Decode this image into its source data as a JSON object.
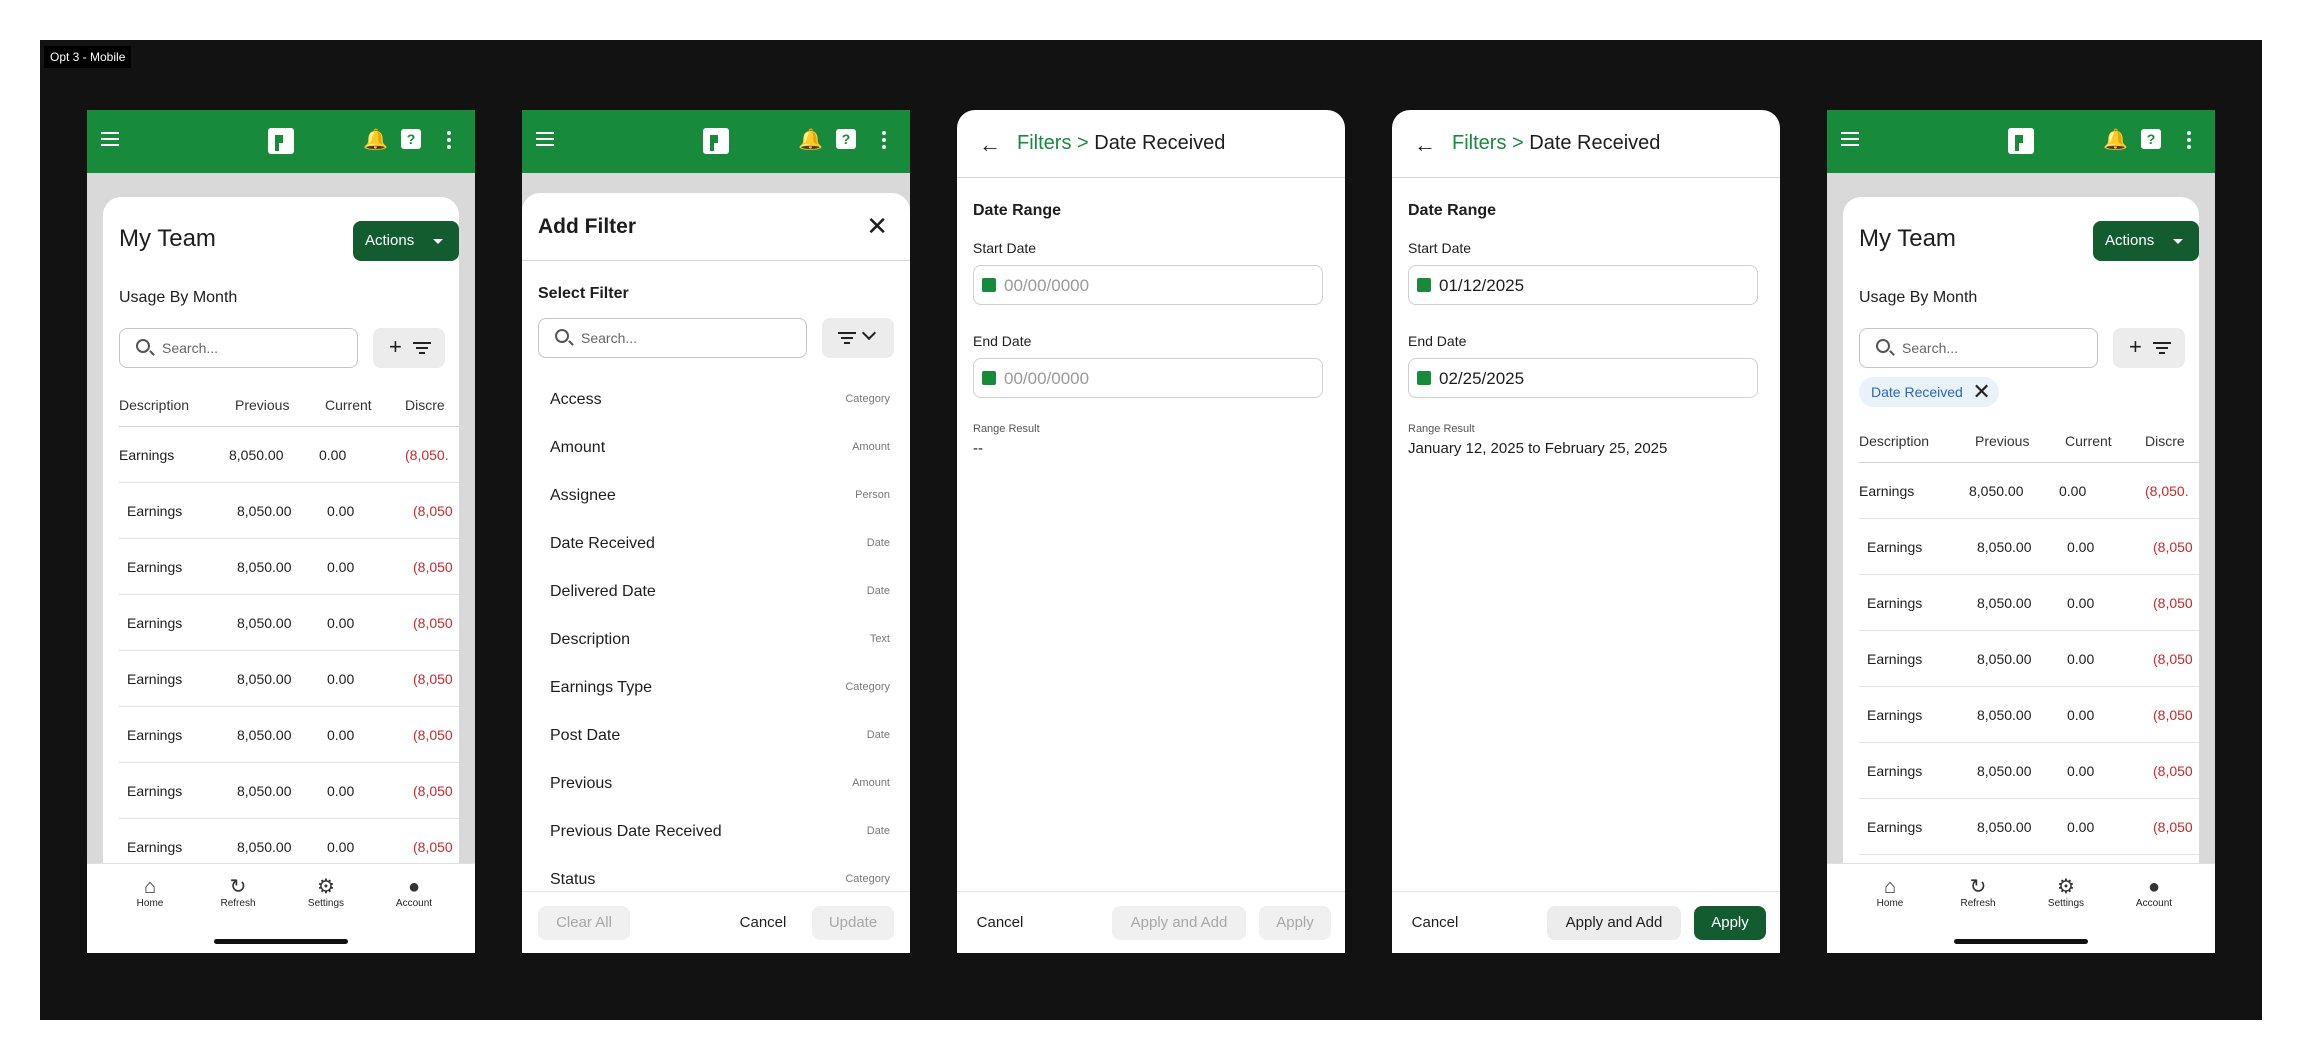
{
  "board_label": "Opt 3 - Mobile",
  "nav": [
    {
      "label": "Home",
      "icon": "home-icon"
    },
    {
      "label": "Refresh",
      "icon": "refresh-icon"
    },
    {
      "label": "Settings",
      "icon": "settings-icon"
    },
    {
      "label": "Account",
      "icon": "account-icon"
    }
  ],
  "team": {
    "title": "My Team",
    "actions_label": "Actions",
    "usage_label": "Usage By Month",
    "search_placeholder": "Search...",
    "columns": [
      "Description",
      "Previous",
      "Current",
      "Discre"
    ],
    "rows": [
      [
        "Earnings",
        "8,050.00",
        "0.00",
        "(8,050."
      ],
      [
        "Earnings",
        "8,050.00",
        "0.00",
        "(8,050"
      ],
      [
        "Earnings",
        "8,050.00",
        "0.00",
        "(8,050"
      ],
      [
        "Earnings",
        "8,050.00",
        "0.00",
        "(8,050"
      ],
      [
        "Earnings",
        "8,050.00",
        "0.00",
        "(8,050"
      ],
      [
        "Earnings",
        "8,050.00",
        "0.00",
        "(8,050"
      ],
      [
        "Earnings",
        "8,050.00",
        "0.00",
        "(8,050"
      ],
      [
        "Earnings",
        "8,050.00",
        "0.00",
        "(8,050"
      ]
    ],
    "chip_label": "Date Received"
  },
  "add_filter": {
    "title": "Add Filter",
    "select_label": "Select Filter",
    "search_placeholder": "Search...",
    "items": [
      {
        "name": "Access",
        "type": "Category"
      },
      {
        "name": "Amount",
        "type": "Amount"
      },
      {
        "name": "Assignee",
        "type": "Person"
      },
      {
        "name": "Date Received",
        "type": "Date"
      },
      {
        "name": "Delivered Date",
        "type": "Date"
      },
      {
        "name": "Description",
        "type": "Text"
      },
      {
        "name": "Earnings Type",
        "type": "Category"
      },
      {
        "name": "Post Date",
        "type": "Date"
      },
      {
        "name": "Previous",
        "type": "Amount"
      },
      {
        "name": "Previous Date Received",
        "type": "Date"
      },
      {
        "name": "Status",
        "type": "Category"
      }
    ],
    "clear_label": "Clear All",
    "cancel_label": "Cancel",
    "update_label": "Update"
  },
  "date_filter": {
    "crumb_parent": "Filters >",
    "crumb_current": "Date Received",
    "range_label": "Date Range",
    "start_label": "Start Date",
    "end_label": "End Date",
    "result_label": "Range Result",
    "cancel_label": "Cancel",
    "apply_add_label": "Apply and Add",
    "apply_label": "Apply",
    "empty": {
      "start_placeholder": "00/00/0000",
      "end_placeholder": "00/00/0000",
      "result": "--"
    },
    "filled": {
      "start_value": "01/12/2025",
      "end_value": "02/25/2025",
      "result": "January 12, 2025 to February 25, 2025"
    }
  },
  "colors": {
    "brand_green": "#178a3c",
    "dark_green": "#125c30",
    "negative_red": "#c62828",
    "chip_blue": "#2868b8"
  }
}
